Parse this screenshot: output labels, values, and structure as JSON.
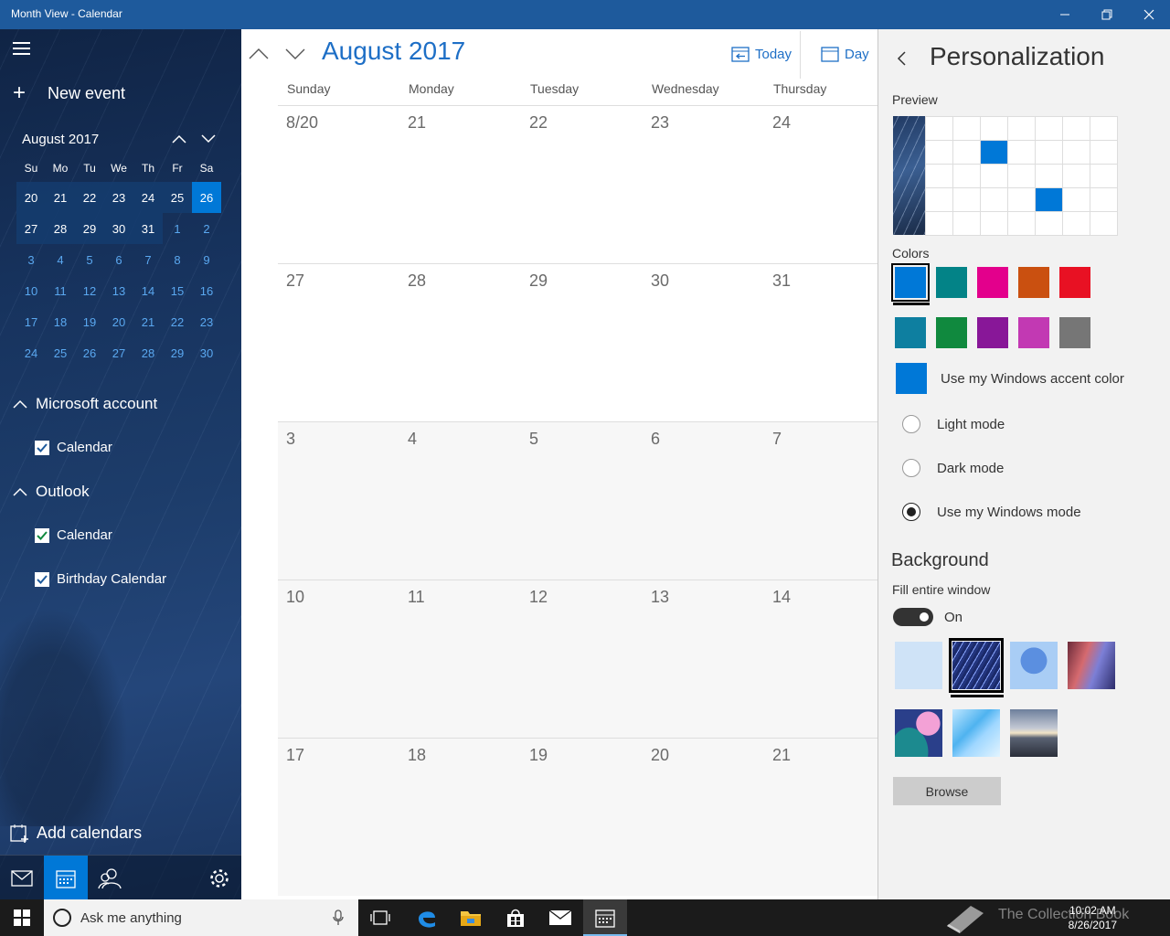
{
  "window": {
    "title": "Month View - Calendar",
    "controls": [
      "minimize",
      "restore",
      "close"
    ]
  },
  "sidebar": {
    "new_event_label": "New event",
    "mini_calendar": {
      "title": "August 2017",
      "weekday_headers": [
        "Su",
        "Mo",
        "Tu",
        "We",
        "Th",
        "Fr",
        "Sa"
      ],
      "rows": [
        [
          "20",
          "21",
          "22",
          "23",
          "24",
          "25",
          "26"
        ],
        [
          "27",
          "28",
          "29",
          "30",
          "31",
          "1",
          "2"
        ],
        [
          "3",
          "4",
          "5",
          "6",
          "7",
          "8",
          "9"
        ],
        [
          "10",
          "11",
          "12",
          "13",
          "14",
          "15",
          "16"
        ],
        [
          "17",
          "18",
          "19",
          "20",
          "21",
          "22",
          "23"
        ],
        [
          "24",
          "25",
          "26",
          "27",
          "28",
          "29",
          "30"
        ]
      ],
      "today": "26"
    },
    "accounts": [
      {
        "label": "Microsoft account",
        "calendars": [
          {
            "label": "Calendar",
            "checked": true
          }
        ]
      },
      {
        "label": "Outlook",
        "calendars": [
          {
            "label": "Calendar",
            "checked": true
          },
          {
            "label": "Birthday Calendar",
            "checked": true
          }
        ]
      }
    ],
    "add_calendars_label": "Add calendars",
    "bottom_icons": [
      "mail-icon",
      "calendar-icon",
      "people-icon",
      "settings-gear-icon"
    ]
  },
  "main": {
    "month_title": "August 2017",
    "today_label": "Today",
    "day_label": "Day",
    "weekdays": [
      "Sunday",
      "Monday",
      "Tuesday",
      "Wednesday",
      "Thursday"
    ],
    "weeks": [
      [
        "8/20",
        "21",
        "22",
        "23",
        "24"
      ],
      [
        "27",
        "28",
        "29",
        "30",
        "31"
      ],
      [
        "3",
        "4",
        "5",
        "6",
        "7"
      ],
      [
        "10",
        "11",
        "12",
        "13",
        "14"
      ],
      [
        "17",
        "18",
        "19",
        "20",
        "21"
      ]
    ]
  },
  "personalization": {
    "title": "Personalization",
    "preview_label": "Preview",
    "colors_label": "Colors",
    "colors": [
      "#0078d7",
      "#038387",
      "#e3008c",
      "#ca5010",
      "#e81123",
      "#0e7fa0",
      "#10893e",
      "#881798",
      "#c239b3",
      "#767676"
    ],
    "selected_color": "#0078d7",
    "accent_label": "Use my Windows accent color",
    "modes": [
      {
        "label": "Light mode",
        "selected": false
      },
      {
        "label": "Dark mode",
        "selected": false
      },
      {
        "label": "Use my Windows mode",
        "selected": true
      }
    ],
    "background_title": "Background",
    "fill_label": "Fill entire window",
    "toggle_state": "On",
    "backgrounds": [
      "plain-light-blue",
      "star-trails",
      "blue-tree",
      "canyon",
      "colorful-hills",
      "blue-polygons",
      "sunset-lake"
    ],
    "selected_background": "star-trails",
    "browse_label": "Browse"
  },
  "taskbar": {
    "search_placeholder": "Ask me anything",
    "apps": [
      "task-view-icon",
      "edge-icon",
      "file-explorer-icon",
      "store-icon",
      "mail-icon",
      "calendar-icon"
    ],
    "time": "10:02 AM",
    "date": "8/26/2017",
    "watermark": "The Collection Book"
  }
}
